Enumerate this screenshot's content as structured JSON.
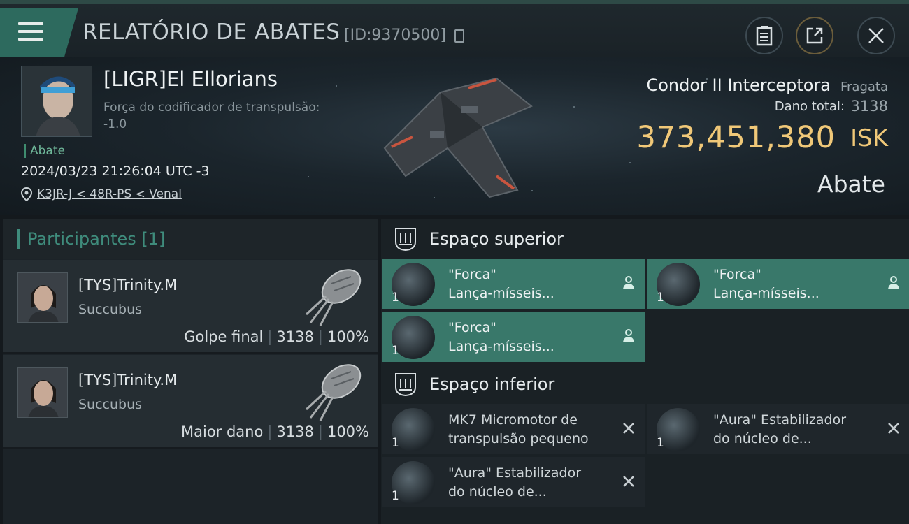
{
  "header": {
    "title": "RELATÓRIO DE ABATES",
    "report_id": "[ID:9370500]",
    "icons": [
      "menu-icon",
      "copy-icon",
      "clipboard-icon",
      "share-icon",
      "close-icon"
    ]
  },
  "victim": {
    "name": "[LIGR]El Ellorians",
    "stat_label": "Força do codificador de transpulsão:",
    "stat_value": "-1.0",
    "badge": "Abate",
    "time": "2024/03/23 21:26:04 UTC -3",
    "location": "K3JR-J < 48R-PS < Venal",
    "ship_name": "Condor II Interceptora",
    "ship_class": "Fragata",
    "damage_label": "Dano total:",
    "damage_value": "3138",
    "isk_value": "373,451,380",
    "isk_unit": "ISK",
    "kill_type": "Abate"
  },
  "participants": {
    "title": "Participantes [1]",
    "items": [
      {
        "name": "[TYS]Trinity.M",
        "ship": "Succubus",
        "role": "Golpe final",
        "damage": "3138",
        "percent": "100%"
      },
      {
        "name": "[TYS]Trinity.M",
        "ship": "Succubus",
        "role": "Maior dano",
        "damage": "3138",
        "percent": "100%"
      }
    ]
  },
  "slots": {
    "high": {
      "title": "Espaço superior",
      "items": [
        {
          "line1": "\"Forca\"",
          "line2": "Lança-mísseis...",
          "qty": "1",
          "status": "dropped"
        },
        {
          "line1": "\"Forca\"",
          "line2": "Lança-mísseis...",
          "qty": "1",
          "status": "dropped"
        },
        {
          "line1": "\"Forca\"",
          "line2": "Lança-mísseis...",
          "qty": "1",
          "status": "dropped"
        }
      ]
    },
    "low": {
      "title": "Espaço inferior",
      "items": [
        {
          "line1": "MK7 Micromotor de",
          "line2": "transpulsão pequeno",
          "qty": "1",
          "status": "destroyed"
        },
        {
          "line1": "\"Aura\" Estabilizador",
          "line2": "do núcleo de...",
          "qty": "1",
          "status": "destroyed"
        },
        {
          "line1": "\"Aura\" Estabilizador",
          "line2": "do núcleo de...",
          "qty": "1",
          "status": "destroyed"
        }
      ]
    }
  },
  "colors": {
    "accent": "#3f8c7c",
    "isk": "#f0c878",
    "dropped_bg": "#39786a"
  }
}
